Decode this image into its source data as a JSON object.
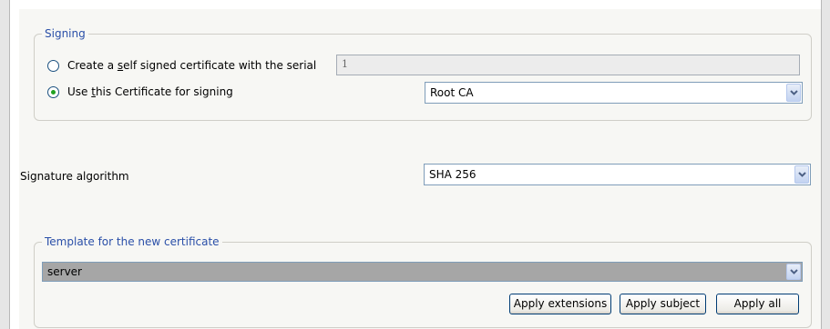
{
  "signing": {
    "legend": "Signing",
    "selfsigned": {
      "label_pre": "Create a ",
      "label_mnemonic": "s",
      "label_post": "elf signed certificate with the serial",
      "selected": false,
      "serial_value": "1"
    },
    "usecert": {
      "label_pre": "Use ",
      "label_mnemonic": "t",
      "label_post": "his Certificate for signing",
      "selected": true,
      "selected_ca": "Root CA"
    }
  },
  "signature": {
    "label": "Signature algorithm",
    "value": "SHA 256"
  },
  "template": {
    "legend": "Template for the new certificate",
    "value": "server",
    "buttons": {
      "apply_extensions": "Apply extensions",
      "apply_subject": "Apply subject",
      "apply_all": "Apply all"
    }
  },
  "colors": {
    "legend_text": "#2a4fa8",
    "radio_dot": "#21a121",
    "button_border": "#003c74"
  },
  "icons": {
    "dropdown": "chevron-down-icon"
  }
}
